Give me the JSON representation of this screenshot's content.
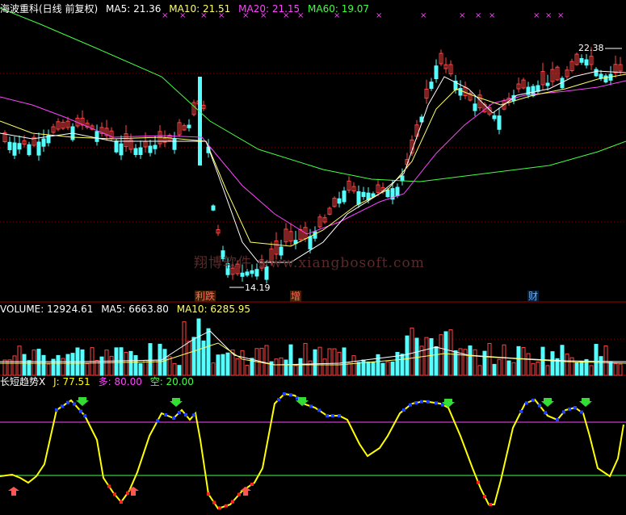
{
  "price_panel": {
    "title": "海波重科(日线 前复权)",
    "ma5": {
      "label": "MA5: 21.36",
      "color": "#ffffff"
    },
    "ma10": {
      "label": "MA10: 21.51",
      "color": "#ffff66"
    },
    "ma20": {
      "label": "MA20: 21.15",
      "color": "#ff44ff"
    },
    "ma60": {
      "label": "MA60: 19.07",
      "color": "#44ff44"
    },
    "high_label": "22.38",
    "low_label": "14.19",
    "markers": {
      "m1": "利跌",
      "m2": "增",
      "m3": "财"
    }
  },
  "volume_panel": {
    "title": "VOLUME: 12924.61",
    "ma5": {
      "label": "MA5: 6663.80",
      "color": "#ffffff"
    },
    "ma10": {
      "label": "MA10: 6285.95",
      "color": "#ffff66"
    }
  },
  "indicator_panel": {
    "title": "长短趋势X",
    "j": {
      "label": "J: 77.51",
      "color": "#ffff00"
    },
    "duo": {
      "label": "多: 80.00",
      "color": "#ff44ff"
    },
    "kong": {
      "label": "空: 20.00",
      "color": "#44ff44"
    }
  },
  "watermark": "翔博软件 www.xiangbosoft.com",
  "colors": {
    "up": "#ff4444",
    "down": "#55ffff",
    "grid": "#880000",
    "ma5": "#ffffff",
    "ma10": "#ffff66",
    "ma20": "#ff44ff",
    "ma60": "#44ff44",
    "j_line": "#ffff00",
    "dot_blue": "#2244ff",
    "dot_red": "#ff2222",
    "arrow_green": "#33dd33",
    "arrow_red": "#ff5555"
  },
  "chart_data": {
    "type": "candlestick",
    "high": 22.38,
    "low": 14.19,
    "indicator_levels": {
      "duo": 80,
      "kong": 20
    }
  }
}
